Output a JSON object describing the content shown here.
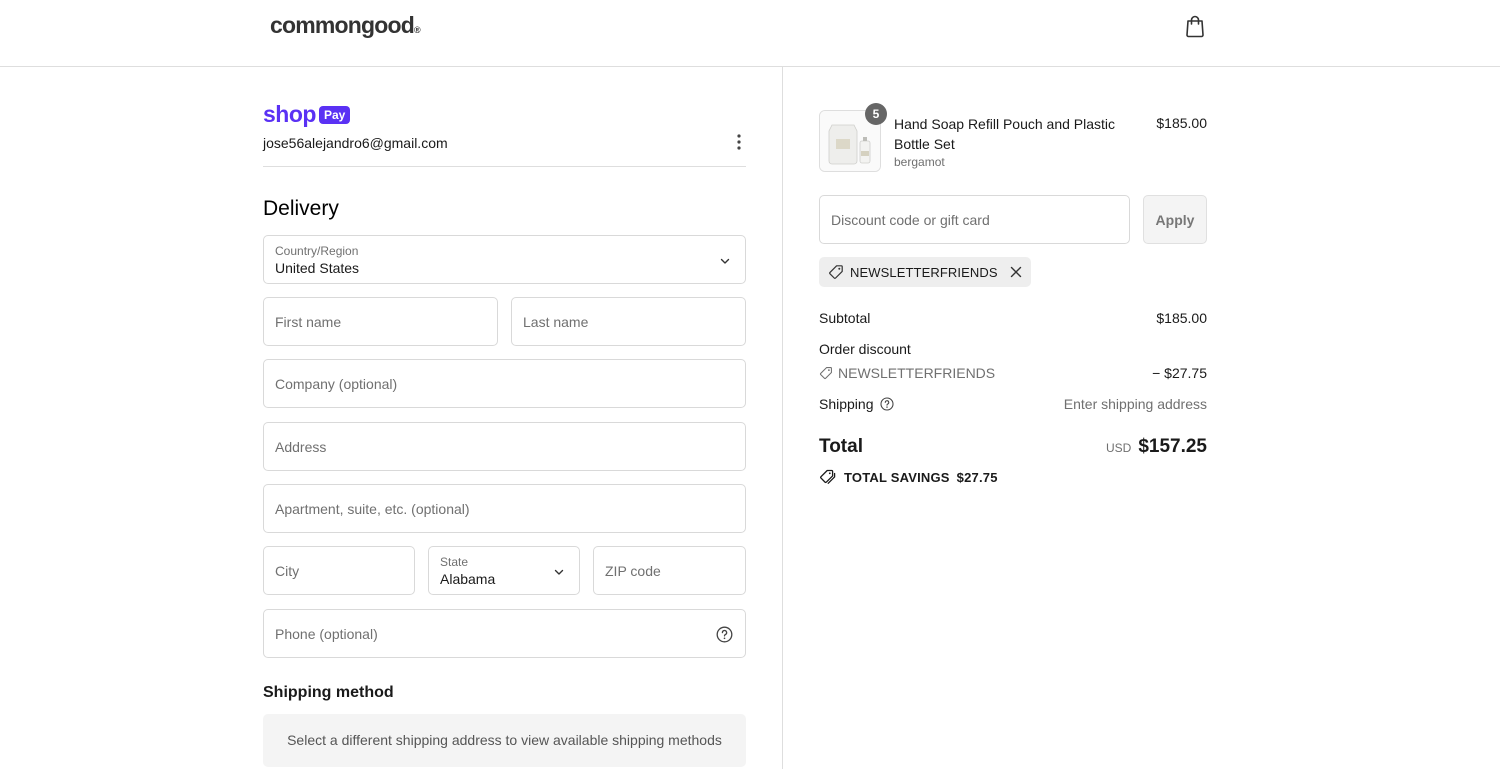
{
  "header": {
    "logo_text": "commongood",
    "logo_mark": "®",
    "cart_icon": "shopping-bag-icon"
  },
  "shop_pay": {
    "brand": "shop",
    "pill": "Pay",
    "email": "jose56alejandro6@gmail.com",
    "menu_icon": "kebab-menu-icon"
  },
  "delivery": {
    "heading": "Delivery",
    "country_label": "Country/Region",
    "country_value": "United States",
    "first_name_placeholder": "First name",
    "last_name_placeholder": "Last name",
    "company_placeholder": "Company (optional)",
    "address_placeholder": "Address",
    "apartment_placeholder": "Apartment, suite, etc. (optional)",
    "city_placeholder": "City",
    "state_label": "State",
    "state_value": "Alabama",
    "zip_placeholder": "ZIP code",
    "phone_placeholder": "Phone (optional)"
  },
  "shipping_method": {
    "heading": "Shipping method",
    "note": "Select a different shipping address to view available shipping methods"
  },
  "summary": {
    "product": {
      "quantity": "5",
      "name": "Hand Soap Refill Pouch and Plastic Bottle Set",
      "variant": "bergamot",
      "price": "$185.00"
    },
    "discount_placeholder": "Discount code or gift card",
    "apply_label": "Apply",
    "applied_code": "NEWSLETTERFRIENDS",
    "subtotal_label": "Subtotal",
    "subtotal_value": "$185.00",
    "order_discount_label": "Order discount",
    "discount_code": "NEWSLETTERFRIENDS",
    "discount_value": "− $27.75",
    "shipping_label": "Shipping",
    "shipping_value": "Enter shipping address",
    "total_label": "Total",
    "total_currency": "USD",
    "total_value": "$157.25",
    "savings_label": "TOTAL SAVINGS",
    "savings_value": "$27.75"
  },
  "colors": {
    "shop_pay_purple": "#5a31f4",
    "border": "#d9d9d9",
    "muted_text": "#707070"
  }
}
